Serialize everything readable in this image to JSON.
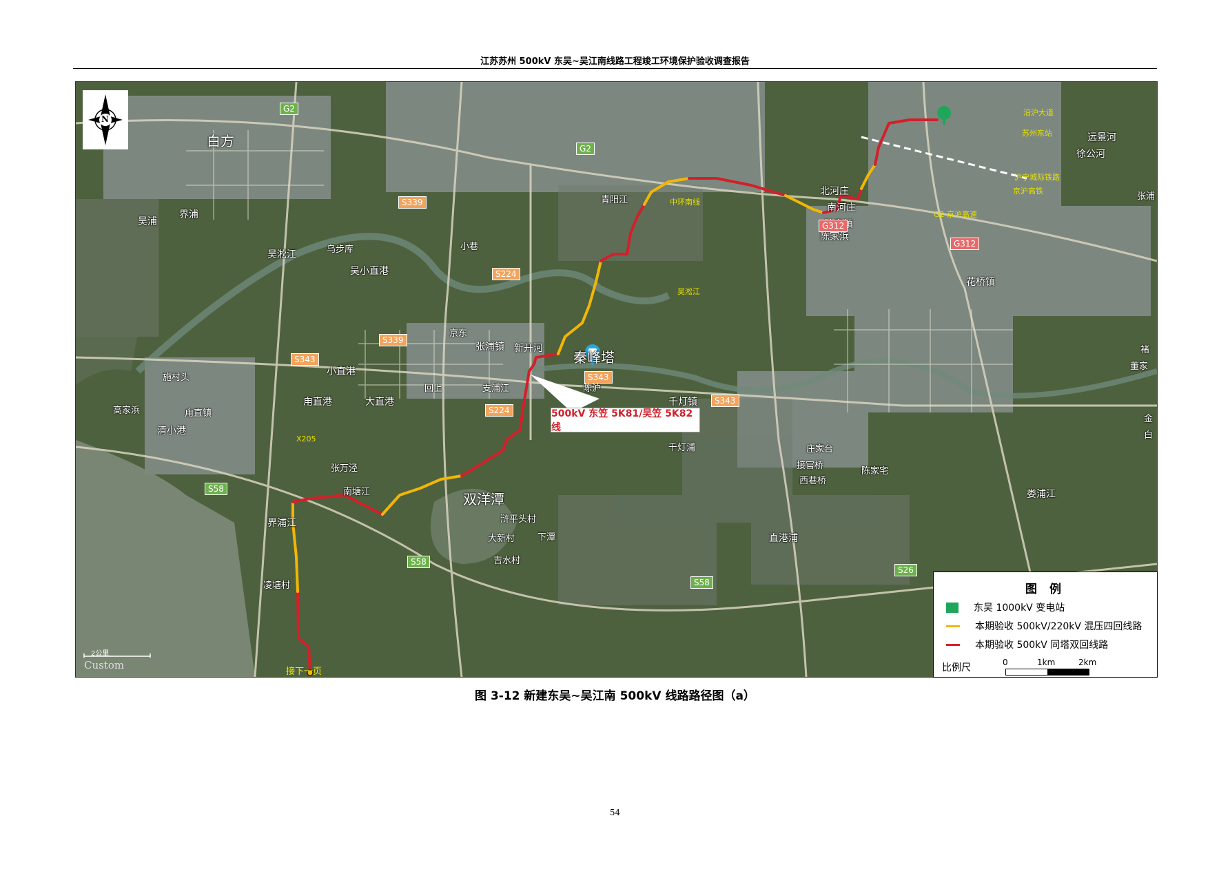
{
  "header": {
    "title": "江苏苏州 500kV 东吴~吴江南线路工程竣工环境保护验收调查报告"
  },
  "caption": "图 3-12   新建东吴~吴江南 500kV 线路路径图（a）",
  "page_number": "54",
  "compass": {
    "label": "N",
    "icon": "north-arrow-icon"
  },
  "callout": {
    "text": "500kV 东笠 5K81/吴笠 5K82 线"
  },
  "map_scale": {
    "label": "2公里",
    "custom_text": "Custom"
  },
  "next_page_label": "接下一页",
  "legend": {
    "title": "图 例",
    "items": [
      {
        "label": "东吴 1000kV 变电站",
        "color": "#1fa65a",
        "kind": "square"
      },
      {
        "label": "本期验收 500kV/220kV 混压四回线路",
        "color": "#f2b705",
        "kind": "line"
      },
      {
        "label": "本期验收 500kV 同塔双回线路",
        "color": "#d2202a",
        "kind": "line"
      }
    ],
    "scale_label": "比例尺",
    "scale_ticks": [
      "0",
      "1km",
      "2km"
    ]
  },
  "colors": {
    "red_line": "#d2202a",
    "yellow_line": "#f2b705",
    "map_bg": "#3f5232",
    "road_badge": "#f3a45c",
    "highway_badge": "#6db14c",
    "national_badge": "#e66a6a"
  },
  "place_labels": [
    "白方",
    "界浦",
    "吴浦",
    "吴淞江",
    "乌步库",
    "吴小直港",
    "小巷",
    "青阳江",
    "京东",
    "张浦镇",
    "新开河",
    "秦峰塔",
    "小直港",
    "施村头",
    "高家浜",
    "甪直镇",
    "清小港",
    "甪直港",
    "大直港",
    "回上",
    "支浦江",
    "陈沪",
    "千灯镇",
    "千灯浦",
    "北河庄",
    "南河庄",
    "陆家镇",
    "陈家浜",
    "花桥镇",
    "远景河",
    "徐公河",
    "张浦",
    "庄家台",
    "接官桥",
    "陈家宅",
    "西巷桥",
    "双洋潭",
    "张万泾",
    "南塘江",
    "界浦江",
    "凌塘村",
    "浒平头村",
    "大新村",
    "吉水村",
    "下潭",
    "直港浦",
    "娄浦江",
    "褚",
    "董家",
    "金",
    "白"
  ],
  "route_labels": [
    "沿沪大道",
    "苏州东站",
    "京沪高铁",
    "沪宁城际铁路",
    "G2 京沪高速",
    "中环南线",
    "吴淞江",
    "X205"
  ],
  "road_badges": [
    "G2",
    "G2",
    "S339",
    "S339",
    "S343",
    "S343",
    "S343",
    "S224",
    "S224",
    "G312",
    "G312",
    "S58",
    "S58",
    "S58",
    "S26"
  ]
}
